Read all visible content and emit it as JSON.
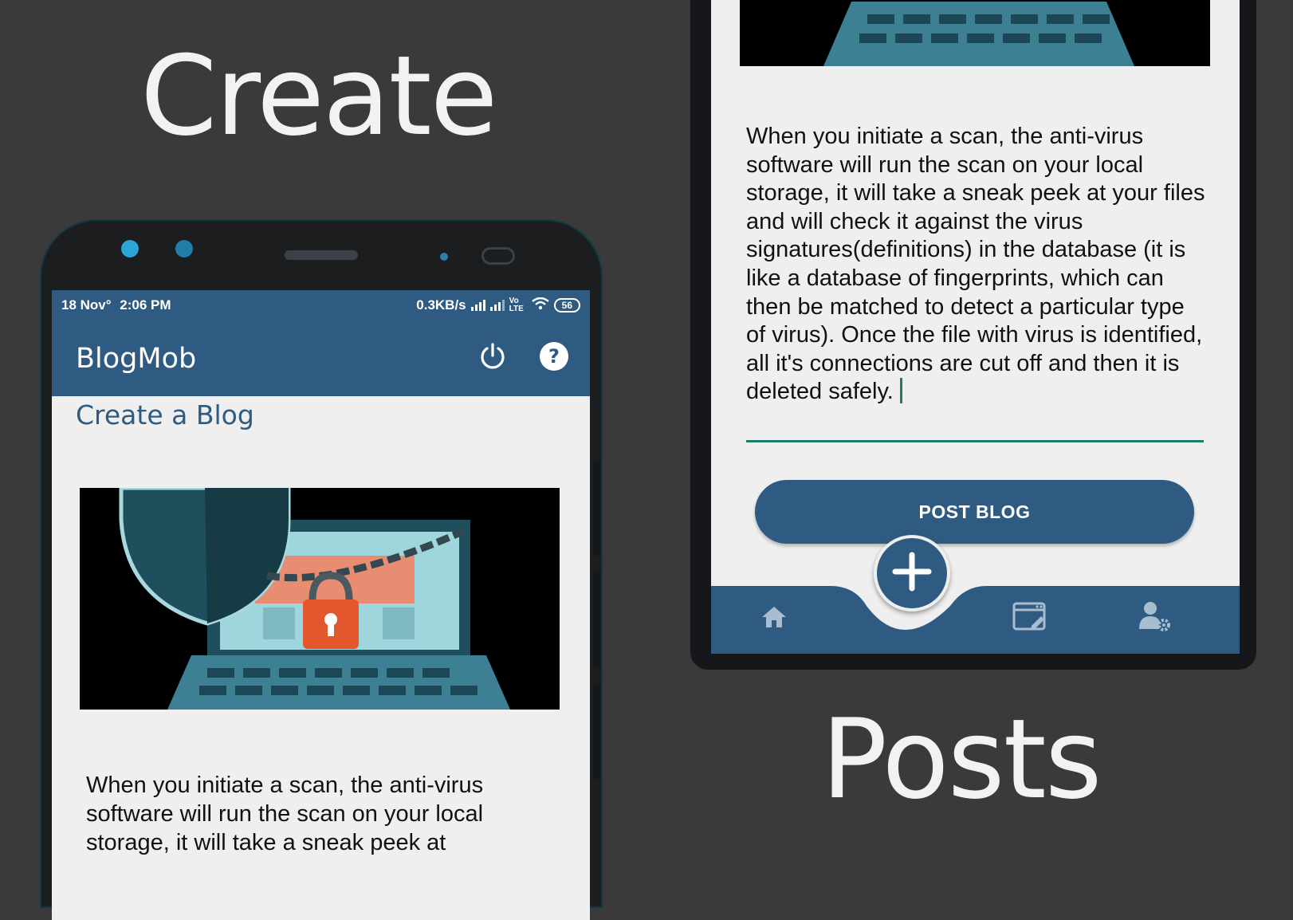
{
  "headlines": {
    "create": "Create",
    "posts": "Posts"
  },
  "status_bar": {
    "date": "18 Nov°",
    "time": "2:06 PM",
    "speed": "0.3KB/s",
    "network": "Vo LTE",
    "battery": "56"
  },
  "app": {
    "title": "BlogMob",
    "page_heading": "Create a Blog",
    "icons": [
      "power-icon",
      "help-icon"
    ]
  },
  "blog": {
    "image_icon": "laptop-shield-lock-illustration",
    "text_left_lines": [
      "When you initiate a scan, the anti-virus",
      "software will run the scan on your local",
      "storage, it will take a sneak peek at"
    ],
    "text": "When you initiate a scan, the anti-virus software will run the scan on your local storage, it will take a sneak peek at your files and will check it against the virus signatures(definitions) in the database (it is like a database of fingerprints, which can then be matched to detect a particular type of virus). Once the file with virus is identified, all it's connections are cut off and then it is deleted safely."
  },
  "actions": {
    "post_button": "POST BLOG"
  },
  "bottom_nav": {
    "items": [
      "home-icon",
      "add-icon",
      "posts-icon",
      "profile-settings-icon"
    ]
  },
  "colors": {
    "background": "#3a3a3a",
    "primary": "#2f5a82",
    "accent_underline": "#1f7a6c",
    "screen": "#efefef"
  }
}
